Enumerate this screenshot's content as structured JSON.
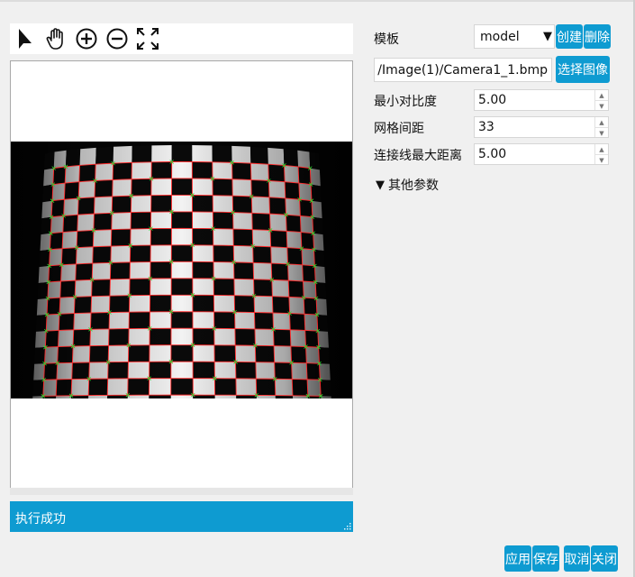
{
  "toolbar": {
    "tools": [
      {
        "name": "select-arrow-icon"
      },
      {
        "name": "pan-hand-icon"
      },
      {
        "name": "zoom-in-icon"
      },
      {
        "name": "zoom-out-icon"
      },
      {
        "name": "fit-view-icon"
      }
    ]
  },
  "status": {
    "text": "执行成功"
  },
  "template": {
    "label": "模板",
    "selected": "model",
    "create_label": "创建",
    "delete_label": "删除"
  },
  "image": {
    "path": "/Image(1)/Camera1_1.bmp",
    "select_label": "选择图像"
  },
  "params": {
    "min_contrast_label": "最小对比度",
    "min_contrast_value": "5.00",
    "grid_spacing_label": "网格间距",
    "grid_spacing_value": "33",
    "max_line_distance_label": "连接线最大距离",
    "max_line_distance_value": "5.00",
    "other_params_label": "其他参数"
  },
  "footer": {
    "apply_label": "应用",
    "save_label": "保存",
    "cancel_label": "取消",
    "close_label": "关闭"
  },
  "colors": {
    "accent": "#0e9bd1",
    "grid_line": "#ff2a2a",
    "corner_mark": "#2ddc2d"
  }
}
